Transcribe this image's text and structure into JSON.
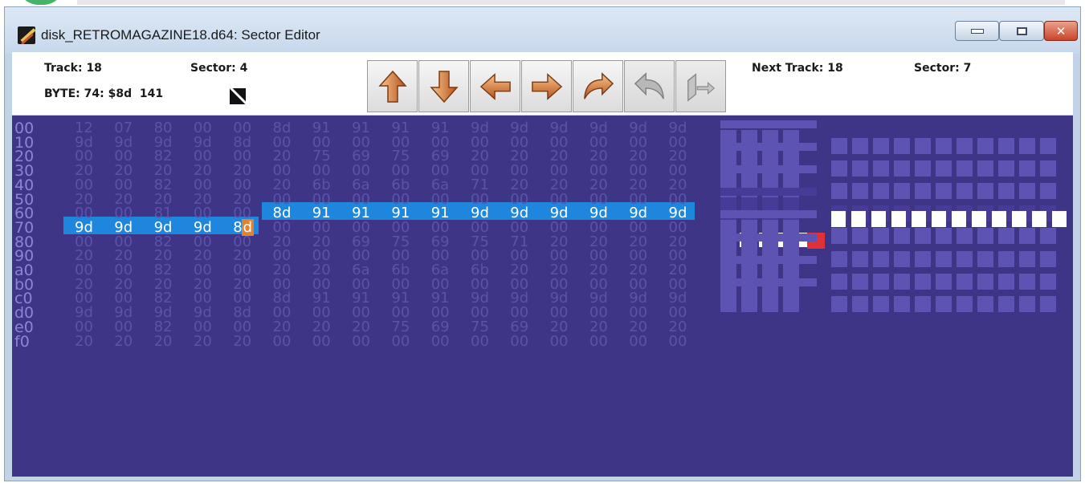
{
  "window": {
    "title": "disk_RETROMAGAZINE18.d64: Sector Editor",
    "controls": [
      "minimize",
      "maximize",
      "close"
    ]
  },
  "toolbar": {
    "track_label": "Track: 18",
    "sector_label": "Sector: 4",
    "byte_label": "BYTE: 74: $8d  141",
    "next_track_label": "Next Track: 18",
    "next_sector_label": "Sector: 7",
    "buttons": [
      {
        "name": "up-arrow-icon",
        "enabled": true
      },
      {
        "name": "down-arrow-icon",
        "enabled": true
      },
      {
        "name": "left-arrow-icon",
        "enabled": true
      },
      {
        "name": "right-arrow-icon",
        "enabled": true
      },
      {
        "name": "forward-arrow-icon",
        "enabled": true
      },
      {
        "name": "back-arrow-icon",
        "enabled": false
      },
      {
        "name": "jump-icon",
        "enabled": false
      }
    ]
  },
  "hex": {
    "rows": [
      {
        "addr": "00",
        "bytes": [
          "12",
          "07",
          "80",
          "00",
          "00",
          "8d",
          "91",
          "91",
          "91",
          "91",
          "9d",
          "9d",
          "9d",
          "9d",
          "9d",
          "9d"
        ]
      },
      {
        "addr": "10",
        "bytes": [
          "9d",
          "9d",
          "9d",
          "9d",
          "8d",
          "00",
          "00",
          "00",
          "00",
          "00",
          "00",
          "00",
          "00",
          "00",
          "00",
          "00"
        ]
      },
      {
        "addr": "20",
        "bytes": [
          "00",
          "00",
          "82",
          "00",
          "00",
          "20",
          "75",
          "69",
          "75",
          "69",
          "20",
          "20",
          "20",
          "20",
          "20",
          "20"
        ]
      },
      {
        "addr": "30",
        "bytes": [
          "20",
          "20",
          "20",
          "20",
          "20",
          "00",
          "00",
          "00",
          "00",
          "00",
          "00",
          "00",
          "00",
          "00",
          "00",
          "00"
        ]
      },
      {
        "addr": "40",
        "bytes": [
          "00",
          "00",
          "82",
          "00",
          "00",
          "20",
          "6b",
          "6a",
          "6b",
          "6a",
          "71",
          "20",
          "20",
          "20",
          "20",
          "20"
        ]
      },
      {
        "addr": "50",
        "bytes": [
          "20",
          "20",
          "20",
          "20",
          "20",
          "00",
          "00",
          "00",
          "00",
          "00",
          "00",
          "00",
          "00",
          "00",
          "00",
          "00"
        ]
      },
      {
        "addr": "60",
        "bytes": [
          "00",
          "00",
          "81",
          "00",
          "00",
          "8d",
          "91",
          "91",
          "91",
          "91",
          "9d",
          "9d",
          "9d",
          "9d",
          "9d",
          "9d"
        ]
      },
      {
        "addr": "70",
        "bytes": [
          "9d",
          "9d",
          "9d",
          "9d",
          "8d",
          "00",
          "00",
          "00",
          "00",
          "00",
          "00",
          "00",
          "00",
          "00",
          "00",
          "00"
        ]
      },
      {
        "addr": "80",
        "bytes": [
          "00",
          "00",
          "82",
          "00",
          "00",
          "20",
          "20",
          "69",
          "75",
          "69",
          "75",
          "71",
          "20",
          "20",
          "20",
          "20"
        ]
      },
      {
        "addr": "90",
        "bytes": [
          "20",
          "20",
          "20",
          "20",
          "20",
          "00",
          "00",
          "00",
          "00",
          "00",
          "00",
          "00",
          "00",
          "00",
          "00",
          "00"
        ]
      },
      {
        "addr": "a0",
        "bytes": [
          "00",
          "00",
          "82",
          "00",
          "00",
          "20",
          "20",
          "6a",
          "6b",
          "6a",
          "6b",
          "20",
          "20",
          "20",
          "20",
          "20"
        ]
      },
      {
        "addr": "b0",
        "bytes": [
          "20",
          "20",
          "20",
          "20",
          "20",
          "00",
          "00",
          "00",
          "00",
          "00",
          "00",
          "00",
          "00",
          "00",
          "00",
          "00"
        ]
      },
      {
        "addr": "c0",
        "bytes": [
          "00",
          "00",
          "82",
          "00",
          "00",
          "8d",
          "91",
          "91",
          "91",
          "91",
          "9d",
          "9d",
          "9d",
          "9d",
          "9d",
          "9d"
        ]
      },
      {
        "addr": "d0",
        "bytes": [
          "9d",
          "9d",
          "9d",
          "9d",
          "8d",
          "00",
          "00",
          "00",
          "00",
          "00",
          "00",
          "00",
          "00",
          "00",
          "00",
          "00"
        ]
      },
      {
        "addr": "e0",
        "bytes": [
          "00",
          "00",
          "82",
          "00",
          "00",
          "20",
          "20",
          "20",
          "75",
          "69",
          "75",
          "69",
          "20",
          "20",
          "20",
          "20"
        ]
      },
      {
        "addr": "f0",
        "bytes": [
          "20",
          "20",
          "20",
          "20",
          "20",
          "00",
          "00",
          "00",
          "00",
          "00",
          "00",
          "00",
          "00",
          "00",
          "00",
          "00"
        ]
      }
    ],
    "selection_start": 101,
    "selection_end": 116,
    "cursor_byte": 116,
    "colors": {
      "panel_bg": "#3e3587",
      "dim_text": "#5a53a8",
      "addr_text": "#8a86d4",
      "selection": "#1f86de",
      "cursor": "#e0822f",
      "petscii_fg": "#5c53b3"
    }
  }
}
